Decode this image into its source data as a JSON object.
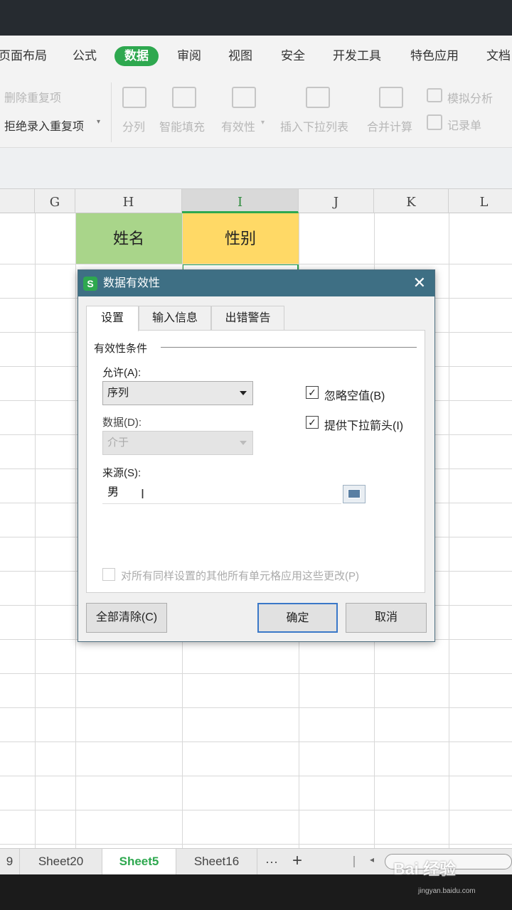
{
  "menubar": {
    "items": [
      "页面布局",
      "公式",
      "数据",
      "审阅",
      "视图",
      "安全",
      "开发工具",
      "特色应用",
      "文档"
    ],
    "active": "数据"
  },
  "ribbon": {
    "remove_duplicates": "删除重复项",
    "reject_duplicates": "拒绝录入重复项",
    "split": "分列",
    "smart_fill": "智能填充",
    "validity": "有效性",
    "insert_dropdown": "插入下拉列表",
    "consolidate": "合并计算",
    "what_if": "模拟分析",
    "record_sheet": "记录单"
  },
  "columns": [
    "G",
    "H",
    "I",
    "J",
    "K",
    "L"
  ],
  "cells": {
    "name_header": "姓名",
    "gender_header": "性别"
  },
  "sheets": {
    "tabs": [
      "9",
      "Sheet20",
      "Sheet5",
      "Sheet16"
    ],
    "active": "Sheet5",
    "more": "···",
    "add": "+"
  },
  "watermark": {
    "brand": "Bai 经验",
    "url": "jingyan.baidu.com"
  },
  "dialog": {
    "logo": "S",
    "title": "数据有效性",
    "close": "✕",
    "tabs": [
      "设置",
      "输入信息",
      "出错警告"
    ],
    "group_label": "有效性条件",
    "allow_label": "允许(A):",
    "allow_value": "序列",
    "data_label": "数据(D):",
    "data_value": "介于",
    "ignore_blank": "忽略空值(B)",
    "dropdown_arrow": "提供下拉箭头(I)",
    "source_label": "来源(S):",
    "source_value": "男",
    "apply_all": "对所有同样设置的其他所有单元格应用这些更改(P)",
    "clear_all": "全部清除(C)",
    "ok": "确定",
    "cancel": "取消",
    "check_mark": "✓"
  },
  "colors": {
    "accent": "#2ea84f",
    "dialog_title": "#3e6f84",
    "name_header_bg": "#a9d58a",
    "gender_header_bg": "#ffd966"
  }
}
